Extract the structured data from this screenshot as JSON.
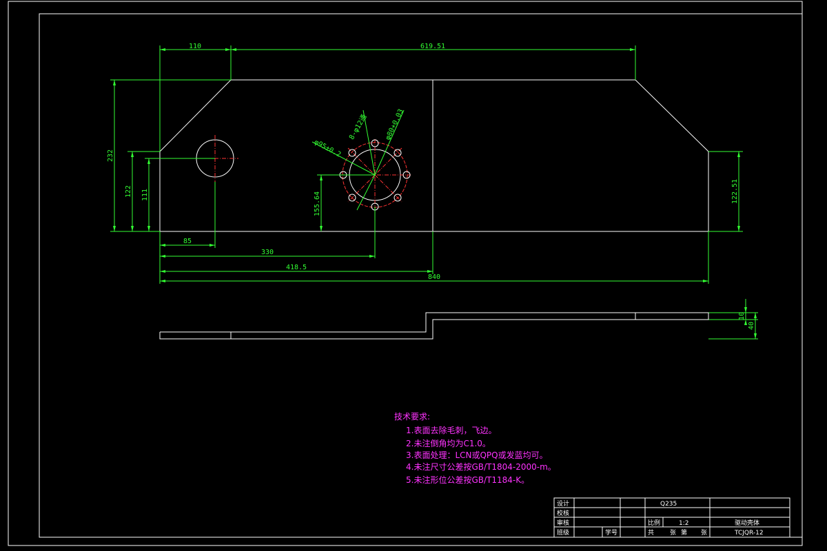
{
  "dimensions": {
    "top_110": "110",
    "top_619": "619.51",
    "left_232": "232",
    "left_122": "122",
    "left_111": "111",
    "right_122": "122.51",
    "hole_55": "155.64",
    "bottom_85": "85",
    "bottom_330": "330",
    "bottom_418": "418.5",
    "bottom_840": "840",
    "bolt_pattern": "8-φ12通",
    "pcd_95": "φ95±0.2",
    "bore_80": "φ80+0.03",
    "side_10": "10",
    "side_40": "40"
  },
  "notes": {
    "title": "技术要求:",
    "items": [
      "1.表面去除毛刺，飞边。",
      "2.未注倒角均为C1.0。",
      "3.表面处理：LCN或QPQ或发蓝均可。",
      "4.未注尺寸公差按GB/T1804-2000-m。",
      "5.未注形位公差按GB/T1184-K。"
    ]
  },
  "title_block": {
    "design": "设计",
    "check": "校核",
    "review": "审核",
    "class": "班级",
    "student_no": "学号",
    "material": "Q235",
    "scale_label": "比例",
    "scale_value": "1:2",
    "sheet_total": "共",
    "sheet_unit": "张",
    "sheet_no": "第",
    "sheet_unit2": "张",
    "part_name": "驱动壳体",
    "drawing_no": "TCJQR-12"
  },
  "colors": {
    "background": "#000000",
    "outline": "#ffffff",
    "dimension": "#33ff33",
    "centerline": "#ff3333",
    "notes": "#ff33ff"
  }
}
